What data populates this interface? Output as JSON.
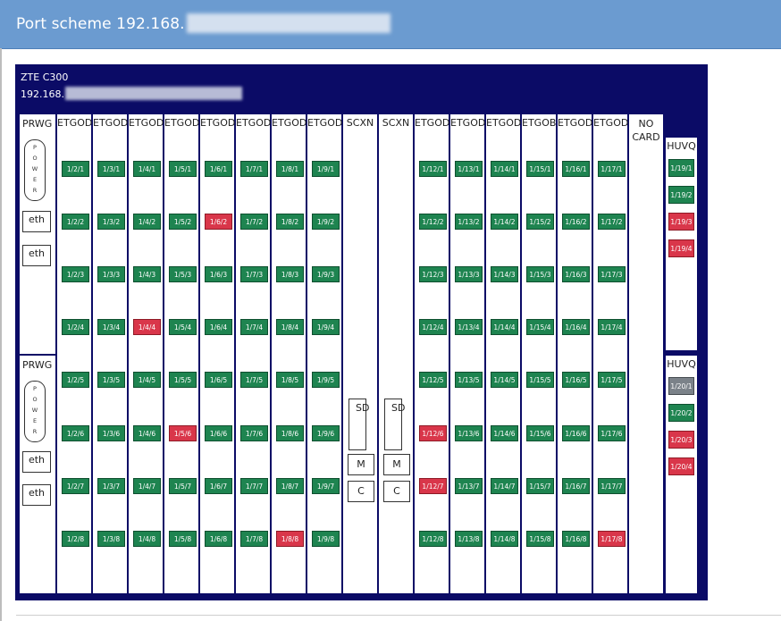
{
  "header": {
    "title": "Port scheme 192.168."
  },
  "chassis": {
    "model": "ZTE C300",
    "ip": "192.168."
  },
  "prwg": {
    "label": "PRWG",
    "power_letters": [
      "P",
      "O",
      "W",
      "E",
      "R"
    ],
    "eth_label": "eth"
  },
  "scxn": {
    "label": "SCXN",
    "sd": "SD",
    "m": "M",
    "c": "C"
  },
  "nocard": {
    "line1": "NO",
    "line2": "CARD"
  },
  "slots": [
    {
      "slot": 2,
      "label": "ETGOD",
      "down": []
    },
    {
      "slot": 3,
      "label": "ETGOD",
      "down": []
    },
    {
      "slot": 4,
      "label": "ETGOD",
      "down": [
        4
      ]
    },
    {
      "slot": 5,
      "label": "ETGOD",
      "down": [
        6
      ]
    },
    {
      "slot": 6,
      "label": "ETGOD",
      "down": [
        2
      ]
    },
    {
      "slot": 7,
      "label": "ETGOD",
      "down": []
    },
    {
      "slot": 8,
      "label": "ETGOD",
      "down": [
        8
      ]
    },
    {
      "slot": 9,
      "label": "ETGOD",
      "down": []
    },
    {
      "slot": 12,
      "label": "ETGOD",
      "down": [
        6,
        7
      ]
    },
    {
      "slot": 13,
      "label": "ETGOD",
      "down": []
    },
    {
      "slot": 14,
      "label": "ETGOD",
      "down": []
    },
    {
      "slot": 15,
      "label": "ETGOB",
      "down": []
    },
    {
      "slot": 16,
      "label": "ETGOD",
      "down": []
    },
    {
      "slot": 17,
      "label": "ETGOD",
      "down": [
        8
      ]
    }
  ],
  "huvq": [
    {
      "label": "HUVQ",
      "ports": [
        {
          "name": "1/19/1",
          "state": "up"
        },
        {
          "name": "1/19/2",
          "state": "up"
        },
        {
          "name": "1/19/3",
          "state": "down"
        },
        {
          "name": "1/19/4",
          "state": "down"
        }
      ]
    },
    {
      "label": "HUVQ",
      "ports": [
        {
          "name": "1/20/1",
          "state": "off"
        },
        {
          "name": "1/20/2",
          "state": "up"
        },
        {
          "name": "1/20/3",
          "state": "down"
        },
        {
          "name": "1/20/4",
          "state": "down"
        }
      ]
    }
  ],
  "colors": {
    "up": "#1e8450",
    "down": "#d9364a",
    "off": "#7b8289",
    "chassis": "#0b0b66",
    "header": "#6b9bd0"
  }
}
